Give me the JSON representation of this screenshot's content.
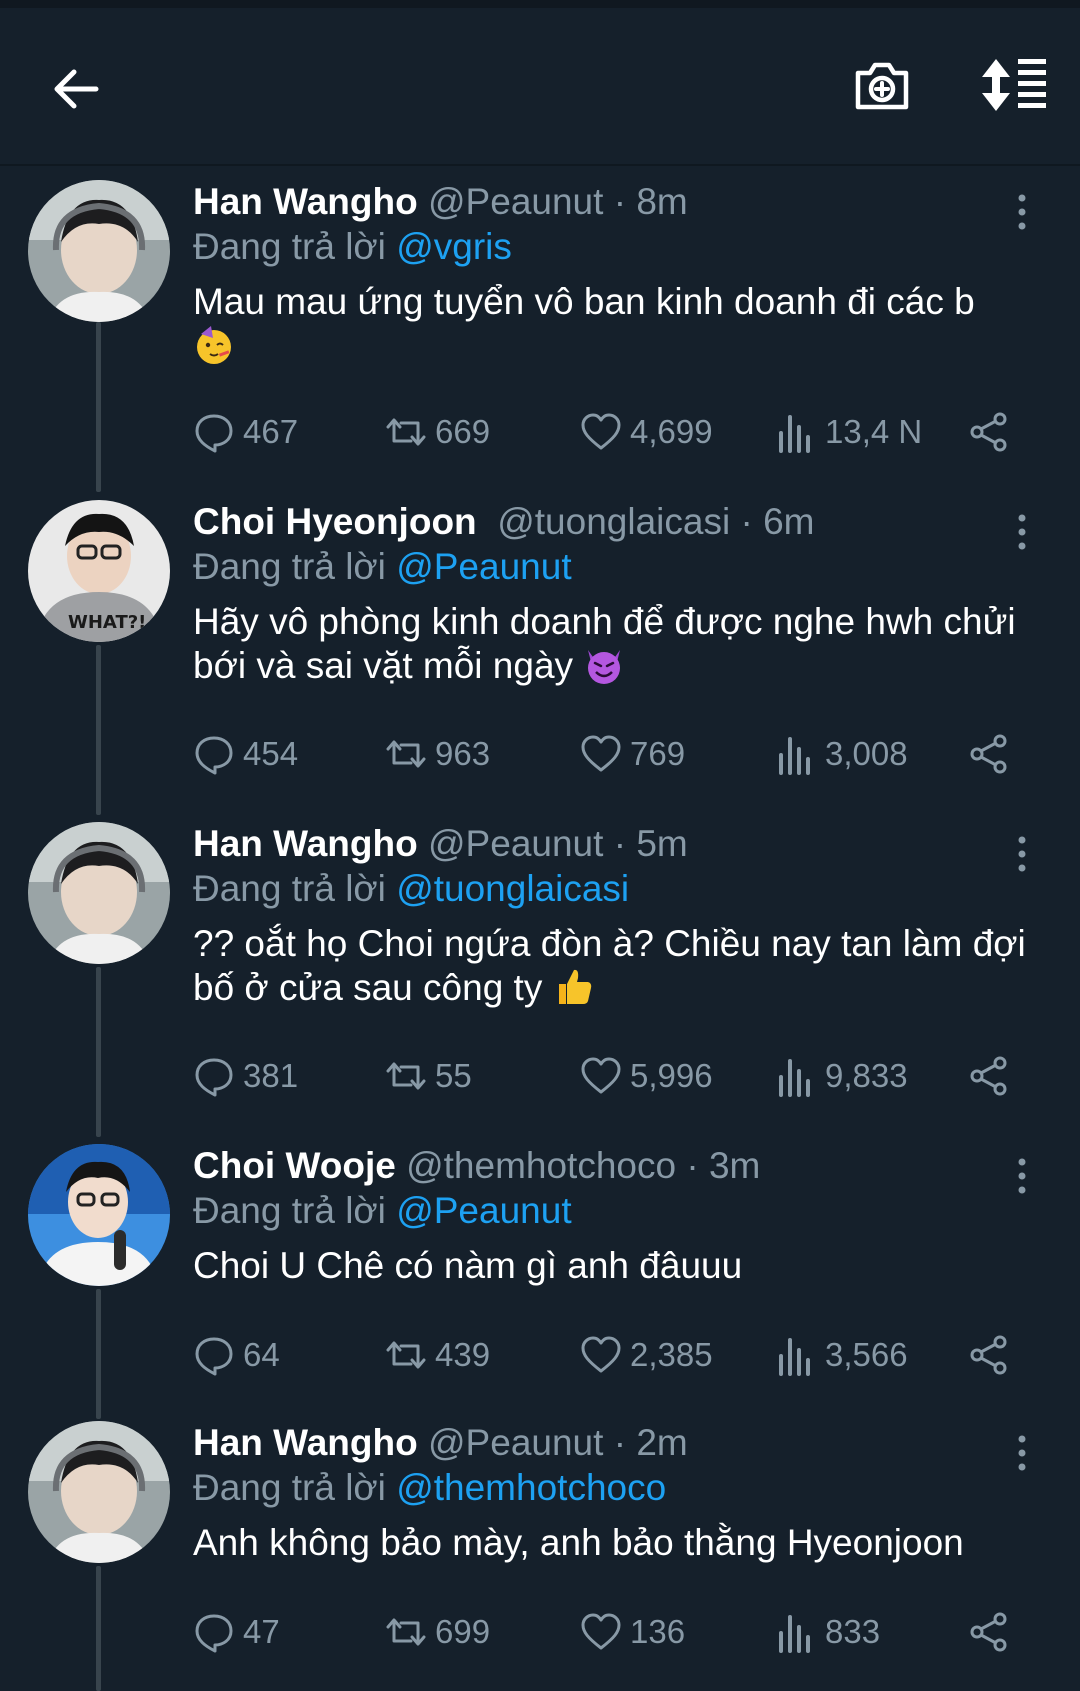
{
  "header": {
    "back_icon": "arrow-left-icon",
    "camera_icon": "camera-plus-icon",
    "sort_icon": "sort-icon"
  },
  "reply_prefix": "Đang trả lời",
  "tweets": [
    {
      "name": "Han Wangho",
      "handle": "@Peaunut",
      "time": "8m",
      "reply_to": "@vgris",
      "text": "Mau mau ứng tuyển vô ban kinh doanh đi các b",
      "emoji": "partying-face-emoji",
      "replies": "467",
      "retweets": "669",
      "likes": "4,699",
      "views": "13,4 N"
    },
    {
      "name": "Choi Hyeonjoon",
      "handle": "@tuonglaicasi",
      "time": "6m",
      "reply_to": "@Peaunut",
      "text": "Hãy vô phòng kinh doanh để được nghe hwh chửi bới và sai vặt mỗi ngày",
      "emoji": "smiling-devil-emoji",
      "replies": "454",
      "retweets": "963",
      "likes": "769",
      "views": "3,008"
    },
    {
      "name": "Han Wangho",
      "handle": "@Peaunut",
      "time": "5m",
      "reply_to": "@tuonglaicasi",
      "text": "?? oắt họ Choi ngứa đòn à? Chiều nay tan làm đợi bố ở cửa sau công ty",
      "emoji": "thumbs-up-emoji",
      "replies": "381",
      "retweets": "55",
      "likes": "5,996",
      "views": "9,833"
    },
    {
      "name": "Choi Wooje",
      "handle": "@themhotchoco",
      "time": "3m",
      "reply_to": "@Peaunut",
      "text": "Choi U Chê có nàm gì anh đâuuu",
      "emoji": "",
      "replies": "64",
      "retweets": "439",
      "likes": "2,385",
      "views": "3,566"
    },
    {
      "name": "Han Wangho",
      "handle": "@Peaunut",
      "time": "2m",
      "reply_to": "@themhotchoco",
      "text": "Anh không bảo mày, anh bảo thằng Hyeonjoon",
      "emoji": "",
      "replies": "47",
      "retweets": "699",
      "likes": "136",
      "views": "833"
    }
  ],
  "colors": {
    "background": "#15202b",
    "secondary_text": "#8899a6",
    "link": "#1da1f2",
    "thread_line": "#38444d"
  }
}
